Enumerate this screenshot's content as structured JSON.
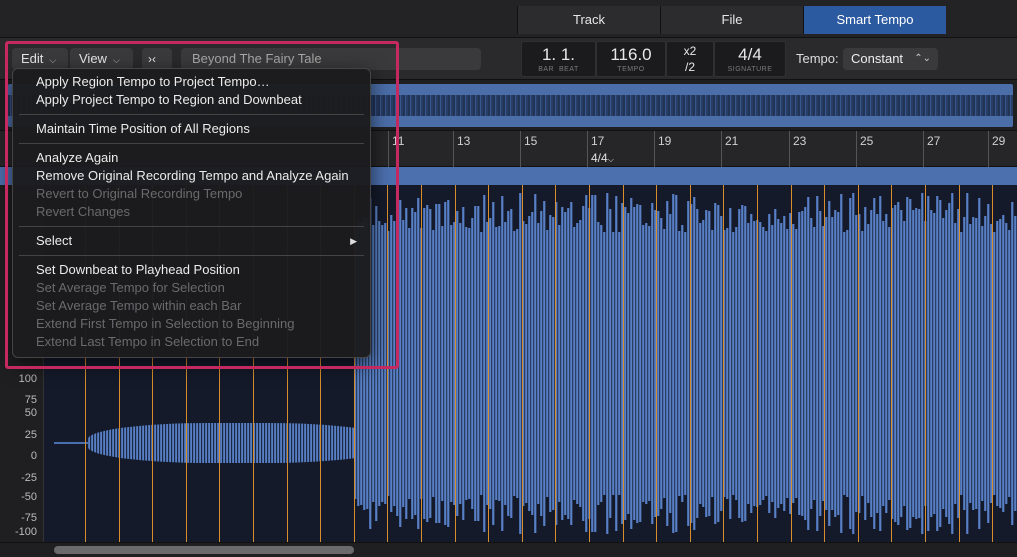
{
  "tabs": [
    {
      "label": "Track"
    },
    {
      "label": "File"
    },
    {
      "label": "Smart Tempo"
    }
  ],
  "toolbar": {
    "edit_label": "Edit",
    "view_label": "View",
    "catch_icon": "catch-playhead-icon",
    "region_name": "Beyond The Fairy Tale",
    "position": {
      "value": "1. 1.",
      "bar_label": "BAR",
      "beat_label": "BEAT"
    },
    "tempo": {
      "value": "116.0",
      "label": "TEMPO"
    },
    "multiply": {
      "x2": "x2",
      "div2": "/2"
    },
    "signature": {
      "value": "4/4",
      "label": "SIGNATURE"
    },
    "tempo_mode_label": "Tempo:",
    "tempo_mode_value": "Constant"
  },
  "ruler": {
    "bars": [
      "11",
      "13",
      "15",
      "17",
      "19",
      "21",
      "23",
      "25",
      "27",
      "29"
    ],
    "signature_marker": "4/4"
  },
  "yaxis": [
    "100",
    "75",
    "50",
    "25",
    "0",
    "-25",
    "-50",
    "-75",
    "-100"
  ],
  "edit_menu": {
    "groups": [
      [
        {
          "label": "Apply Region Tempo to Project Tempo…",
          "enabled": true
        },
        {
          "label": "Apply Project Tempo to Region and Downbeat",
          "enabled": true
        }
      ],
      [
        {
          "label": "Maintain Time Position of All Regions",
          "enabled": true
        }
      ],
      [
        {
          "label": "Analyze Again",
          "enabled": true
        },
        {
          "label": "Remove Original Recording Tempo and Analyze Again",
          "enabled": true
        },
        {
          "label": "Revert to Original Recording Tempo",
          "enabled": false
        },
        {
          "label": "Revert Changes",
          "enabled": false
        }
      ],
      [
        {
          "label": "Select",
          "enabled": true,
          "submenu": true
        }
      ],
      [
        {
          "label": "Set Downbeat to Playhead Position",
          "enabled": true
        },
        {
          "label": "Set Average Tempo for Selection",
          "enabled": false
        },
        {
          "label": "Set Average Tempo within each Bar",
          "enabled": false
        },
        {
          "label": "Extend First Tempo in Selection to Beginning",
          "enabled": false
        },
        {
          "label": "Extend Last Tempo in Selection to End",
          "enabled": false
        }
      ]
    ]
  },
  "colors": {
    "accent": "#2c5aa0",
    "waveform": "#4a6fb0",
    "beat_marker": "#d98c2b",
    "highlight": "#c4295f"
  }
}
